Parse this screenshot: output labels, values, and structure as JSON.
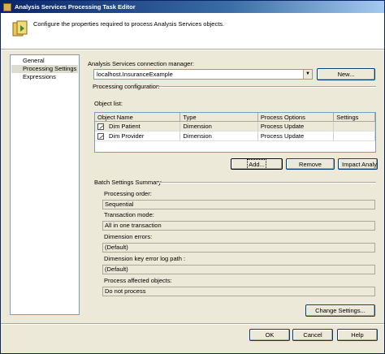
{
  "window": {
    "title": "Analysis Services Processing Task Editor"
  },
  "header": {
    "description": "Configure the properties required to process Analysis Services objects."
  },
  "nav": {
    "items": [
      "General",
      "Processing Settings",
      "Expressions"
    ],
    "selected_index": 1
  },
  "connection": {
    "label": "Analysis Services connection manager:",
    "value": "localhost.InsuranceExample",
    "new_button": "New..."
  },
  "processing": {
    "group_label": "Processing configuration",
    "object_list_label": "Object list:",
    "columns": [
      "Object Name",
      "Type",
      "Process Options",
      "Settings"
    ],
    "rows": [
      {
        "name": "Dim Patient",
        "type": "Dimension",
        "option": "Process Update",
        "settings": ""
      },
      {
        "name": "Dim Provider",
        "type": "Dimension",
        "option": "Process Update",
        "settings": ""
      }
    ],
    "add_button": "Add...",
    "remove_button": "Remove",
    "impact_button": "Impact Analys"
  },
  "batch": {
    "group_label": "Batch Settings Summary",
    "processing_order_label": "Processing order:",
    "processing_order_value": "Sequential",
    "transaction_mode_label": "Transaction mode:",
    "transaction_mode_value": "All in one transaction",
    "dimension_errors_label": "Dimension errors:",
    "dimension_errors_value": "(Default)",
    "key_error_log_label": "Dimension key error log path :",
    "key_error_log_value": "(Default)",
    "process_affected_label": "Process affected objects:",
    "process_affected_value": "Do not process",
    "change_settings_button": "Change Settings..."
  },
  "footer": {
    "ok": "OK",
    "cancel": "Cancel",
    "help": "Help"
  }
}
